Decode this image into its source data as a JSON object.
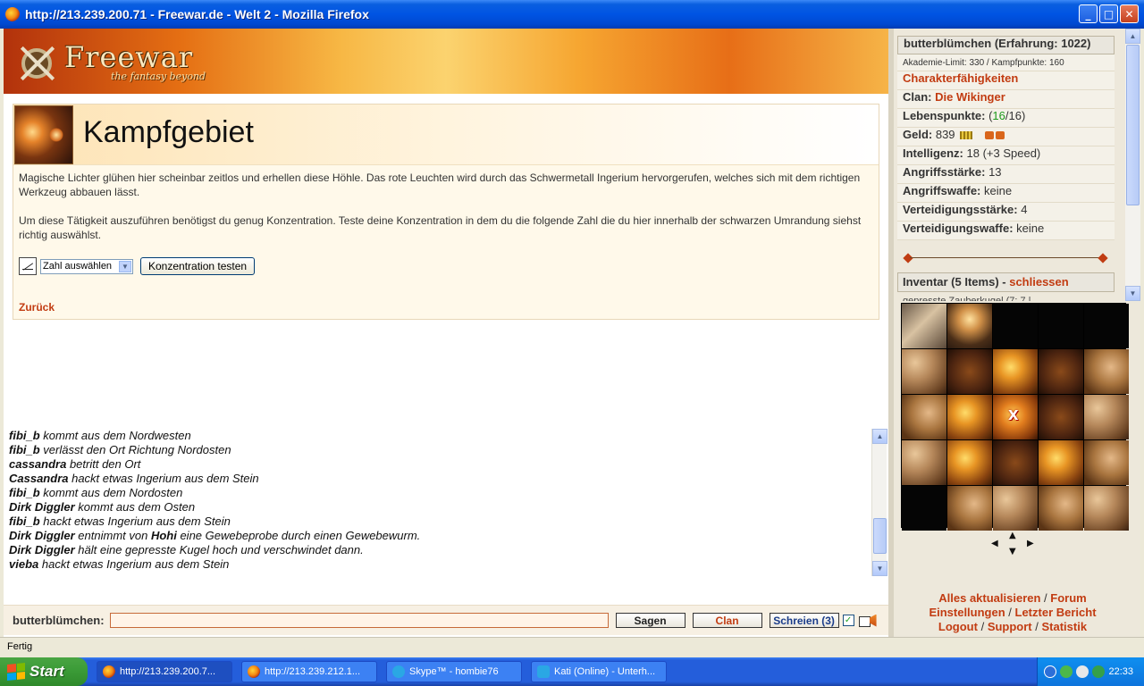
{
  "window": {
    "title": "http://213.239.200.71 - Freewar.de - Welt 2 - Mozilla Firefox",
    "minimize": "_",
    "maximize": "□",
    "close": "✕"
  },
  "logo": {
    "main": "Freewar",
    "sub": "the fantasy beyond"
  },
  "place": {
    "title": "Kampfgebiet",
    "text1": "Magische Lichter glühen hier scheinbar zeitlos und erhellen diese Höhle. Das rote Leuchten wird durch das Schwermetall Ingerium hervorgerufen, welches sich mit dem richtigen Werkzeug abbauen lässt.",
    "text2": "Um diese Tätigkeit auszuführen benötigst du genug Konzentration. Teste deine Konzentration in dem du die folgende Zahl die du hier innerhalb der schwarzen Umrandung siehst richtig auswählst.",
    "select_value": "Zahl auswählen",
    "test_button": "Konzentration testen",
    "back_link": "Zurück"
  },
  "chat": {
    "lines": [
      {
        "name": "fibi_b",
        "text": " kommt aus dem Nordwesten"
      },
      {
        "name": "fibi_b",
        "text": " verlässt den Ort Richtung Nordosten"
      },
      {
        "name": "cassandra",
        "text": " betritt den Ort"
      },
      {
        "name": "Cassandra",
        "text": " hackt etwas Ingerium aus dem Stein"
      },
      {
        "name": "fibi_b",
        "text": " kommt aus dem Nordosten"
      },
      {
        "name": "Dirk Diggler",
        "text": " kommt aus dem Osten"
      },
      {
        "name": "fibi_b",
        "text": " hackt etwas Ingerium aus dem Stein"
      },
      {
        "name": "Dirk Diggler",
        "text": " entnimmt von ",
        "name2": "Hohi",
        "text2": " eine Gewebeprobe durch einen Gewebewurm."
      },
      {
        "name": "Dirk Diggler",
        "text": " hält eine gepresste Kugel hoch und verschwindet dann."
      },
      {
        "name": "vieba",
        "text": " hackt etwas Ingerium aus dem Stein"
      }
    ],
    "input_label": "butterblümchen:",
    "sagen": "Sagen",
    "clan": "Clan",
    "schreien": "Schreien (3)",
    "check": "✓"
  },
  "stats": {
    "head": "butterblümchen (Erfahrung: 1022)",
    "akademie": "Akademie-Limit: 330 / Kampfpunkte: 160",
    "faehigkeiten": "Charakterfähigkeiten",
    "clan_label": "Clan:",
    "clan_value": "Die Wikinger",
    "lp_label": "Lebenspunkte:",
    "lp_open": " (",
    "lp_current": "16",
    "lp_rest": "/16)",
    "geld_label": "Geld:",
    "geld_value": " 839",
    "geld_extra": "( | )",
    "int_label": "Intelligenz:",
    "int_value": " 18 (+3 Speed)",
    "angr_label": "Angriffsstärke:",
    "angr_value": " 13",
    "angrw_label": "Angriffswaffe:",
    "angrw_value": " keine",
    "vert_label": "Verteidigungsstärke:",
    "vert_value": " 4",
    "vertw_label": "Verteidigungswaffe:",
    "vertw_value": " keine"
  },
  "inventory": {
    "head": "Inventar (5 Items)",
    "sep": " - ",
    "close": "schliessen",
    "peek": "gepresste Zauberkugel (7: 7 |"
  },
  "map": {
    "here_marker": "X",
    "nav": {
      "up": "▲",
      "down": "▼",
      "left": "◀",
      "right": "▶"
    }
  },
  "footer": {
    "aktualisieren": "Alles aktualisieren",
    "forum": "Forum",
    "einstellungen": "Einstellungen",
    "bericht": "Letzter Bericht",
    "logout": "Logout",
    "support": "Support",
    "statistik": "Statistik",
    "slash": " / "
  },
  "status": {
    "text": "Fertig"
  },
  "taskbar": {
    "start": "Start",
    "tasks": [
      "http://213.239.200.7...",
      "http://213.239.212.1...",
      "Skype™ - hombie76",
      "Kati (Online) - Unterh..."
    ],
    "clock": "22:33"
  },
  "colors": {
    "accent": "#c23c12",
    "titlebar": "#0054e3",
    "taskbar": "#245edb"
  }
}
